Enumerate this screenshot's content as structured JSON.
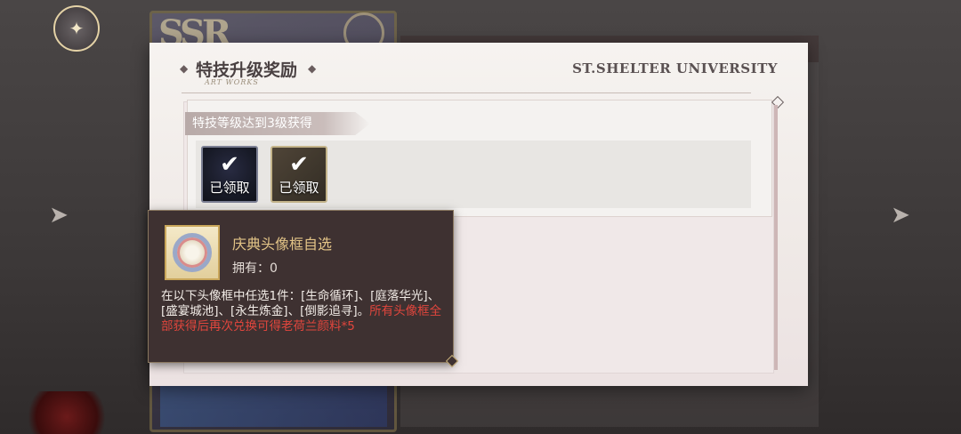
{
  "background": {
    "card_label": "SSR",
    "left_arrow_icon": "left-arrow-icon",
    "right_arrow_icon": "right-arrow-icon",
    "emblem_icon": "compass-emblem-icon"
  },
  "modal": {
    "title": "特技升级奖励",
    "subtitle": "ART WORKS",
    "brand": "ST.SHELTER UNIVERSITY",
    "section_header": "特技等级达到3级获得",
    "rewards": [
      {
        "status_label": "已领取",
        "icon": "checkmark-icon"
      },
      {
        "status_label": "已领取",
        "icon": "checkmark-icon"
      }
    ]
  },
  "tooltip": {
    "item_name": "庆典头像框自选",
    "owned": "拥有：0",
    "description": "在以下头像框中任选1件：[生命循环]、[庭落华光]、[盛宴城池]、[永生炼金]、[倒影追寻]。",
    "description_highlight": "所有头像框全部获得后再次兑换可得老荷兰颜料*5",
    "colors": {
      "highlight": "#e2463d",
      "name": "#e3c487"
    }
  }
}
